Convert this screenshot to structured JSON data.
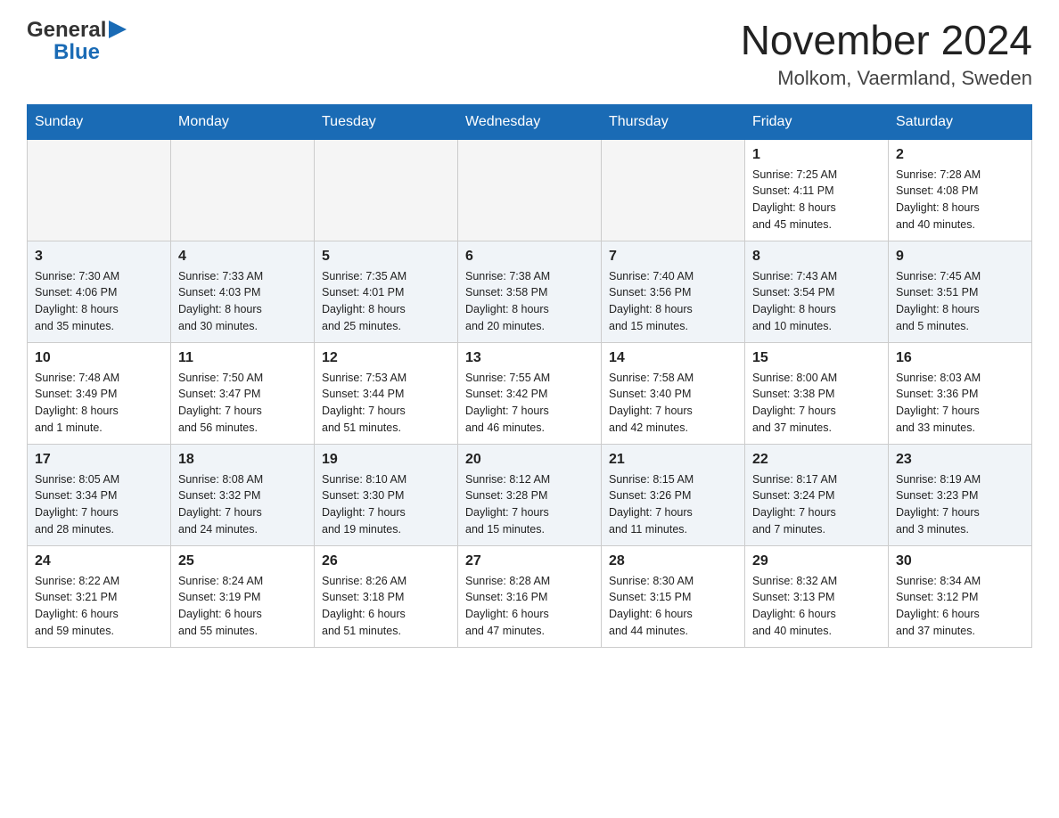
{
  "header": {
    "month_title": "November 2024",
    "location": "Molkom, Vaermland, Sweden",
    "logo_general": "General",
    "logo_blue": "Blue"
  },
  "days_of_week": [
    "Sunday",
    "Monday",
    "Tuesday",
    "Wednesday",
    "Thursday",
    "Friday",
    "Saturday"
  ],
  "weeks": [
    [
      {
        "day": "",
        "info": ""
      },
      {
        "day": "",
        "info": ""
      },
      {
        "day": "",
        "info": ""
      },
      {
        "day": "",
        "info": ""
      },
      {
        "day": "",
        "info": ""
      },
      {
        "day": "1",
        "info": "Sunrise: 7:25 AM\nSunset: 4:11 PM\nDaylight: 8 hours\nand 45 minutes."
      },
      {
        "day": "2",
        "info": "Sunrise: 7:28 AM\nSunset: 4:08 PM\nDaylight: 8 hours\nand 40 minutes."
      }
    ],
    [
      {
        "day": "3",
        "info": "Sunrise: 7:30 AM\nSunset: 4:06 PM\nDaylight: 8 hours\nand 35 minutes."
      },
      {
        "day": "4",
        "info": "Sunrise: 7:33 AM\nSunset: 4:03 PM\nDaylight: 8 hours\nand 30 minutes."
      },
      {
        "day": "5",
        "info": "Sunrise: 7:35 AM\nSunset: 4:01 PM\nDaylight: 8 hours\nand 25 minutes."
      },
      {
        "day": "6",
        "info": "Sunrise: 7:38 AM\nSunset: 3:58 PM\nDaylight: 8 hours\nand 20 minutes."
      },
      {
        "day": "7",
        "info": "Sunrise: 7:40 AM\nSunset: 3:56 PM\nDaylight: 8 hours\nand 15 minutes."
      },
      {
        "day": "8",
        "info": "Sunrise: 7:43 AM\nSunset: 3:54 PM\nDaylight: 8 hours\nand 10 minutes."
      },
      {
        "day": "9",
        "info": "Sunrise: 7:45 AM\nSunset: 3:51 PM\nDaylight: 8 hours\nand 5 minutes."
      }
    ],
    [
      {
        "day": "10",
        "info": "Sunrise: 7:48 AM\nSunset: 3:49 PM\nDaylight: 8 hours\nand 1 minute."
      },
      {
        "day": "11",
        "info": "Sunrise: 7:50 AM\nSunset: 3:47 PM\nDaylight: 7 hours\nand 56 minutes."
      },
      {
        "day": "12",
        "info": "Sunrise: 7:53 AM\nSunset: 3:44 PM\nDaylight: 7 hours\nand 51 minutes."
      },
      {
        "day": "13",
        "info": "Sunrise: 7:55 AM\nSunset: 3:42 PM\nDaylight: 7 hours\nand 46 minutes."
      },
      {
        "day": "14",
        "info": "Sunrise: 7:58 AM\nSunset: 3:40 PM\nDaylight: 7 hours\nand 42 minutes."
      },
      {
        "day": "15",
        "info": "Sunrise: 8:00 AM\nSunset: 3:38 PM\nDaylight: 7 hours\nand 37 minutes."
      },
      {
        "day": "16",
        "info": "Sunrise: 8:03 AM\nSunset: 3:36 PM\nDaylight: 7 hours\nand 33 minutes."
      }
    ],
    [
      {
        "day": "17",
        "info": "Sunrise: 8:05 AM\nSunset: 3:34 PM\nDaylight: 7 hours\nand 28 minutes."
      },
      {
        "day": "18",
        "info": "Sunrise: 8:08 AM\nSunset: 3:32 PM\nDaylight: 7 hours\nand 24 minutes."
      },
      {
        "day": "19",
        "info": "Sunrise: 8:10 AM\nSunset: 3:30 PM\nDaylight: 7 hours\nand 19 minutes."
      },
      {
        "day": "20",
        "info": "Sunrise: 8:12 AM\nSunset: 3:28 PM\nDaylight: 7 hours\nand 15 minutes."
      },
      {
        "day": "21",
        "info": "Sunrise: 8:15 AM\nSunset: 3:26 PM\nDaylight: 7 hours\nand 11 minutes."
      },
      {
        "day": "22",
        "info": "Sunrise: 8:17 AM\nSunset: 3:24 PM\nDaylight: 7 hours\nand 7 minutes."
      },
      {
        "day": "23",
        "info": "Sunrise: 8:19 AM\nSunset: 3:23 PM\nDaylight: 7 hours\nand 3 minutes."
      }
    ],
    [
      {
        "day": "24",
        "info": "Sunrise: 8:22 AM\nSunset: 3:21 PM\nDaylight: 6 hours\nand 59 minutes."
      },
      {
        "day": "25",
        "info": "Sunrise: 8:24 AM\nSunset: 3:19 PM\nDaylight: 6 hours\nand 55 minutes."
      },
      {
        "day": "26",
        "info": "Sunrise: 8:26 AM\nSunset: 3:18 PM\nDaylight: 6 hours\nand 51 minutes."
      },
      {
        "day": "27",
        "info": "Sunrise: 8:28 AM\nSunset: 3:16 PM\nDaylight: 6 hours\nand 47 minutes."
      },
      {
        "day": "28",
        "info": "Sunrise: 8:30 AM\nSunset: 3:15 PM\nDaylight: 6 hours\nand 44 minutes."
      },
      {
        "day": "29",
        "info": "Sunrise: 8:32 AM\nSunset: 3:13 PM\nDaylight: 6 hours\nand 40 minutes."
      },
      {
        "day": "30",
        "info": "Sunrise: 8:34 AM\nSunset: 3:12 PM\nDaylight: 6 hours\nand 37 minutes."
      }
    ]
  ]
}
